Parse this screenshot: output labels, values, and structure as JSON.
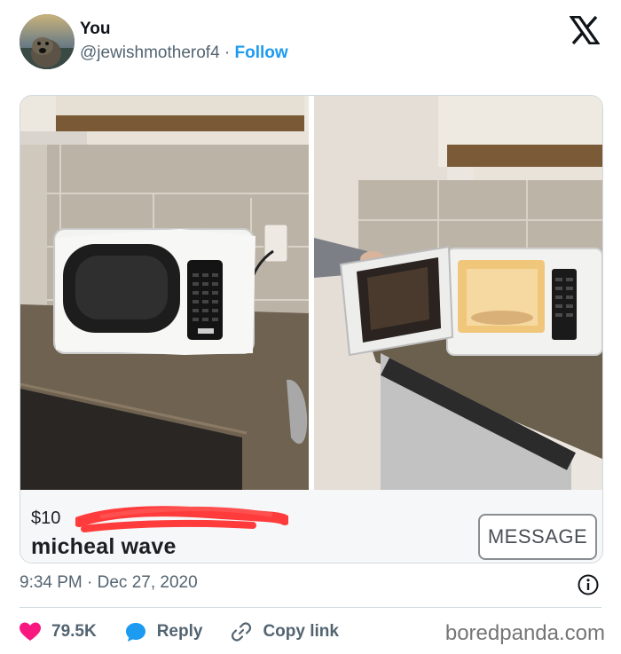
{
  "user": {
    "name": "You",
    "handle": "@jewishmotherof4",
    "separator": " · ",
    "follow_label": "Follow"
  },
  "platform_logo": "x-logo-icon",
  "listing": {
    "price": "$10",
    "title": "micheal wave",
    "message_button": "MESSAGE"
  },
  "tweet": {
    "timestamp": "9:34 PM · Dec 27, 2020"
  },
  "actions": {
    "likes": "79.5K",
    "reply_label": "Reply",
    "copy_link_label": "Copy link"
  },
  "watermark": "boredpanda.com",
  "colors": {
    "accent": "#1d9bf0",
    "like": "#f91880",
    "reply": "#1d9bf0",
    "muted": "#536471",
    "redaction": "#ff3b3b"
  }
}
